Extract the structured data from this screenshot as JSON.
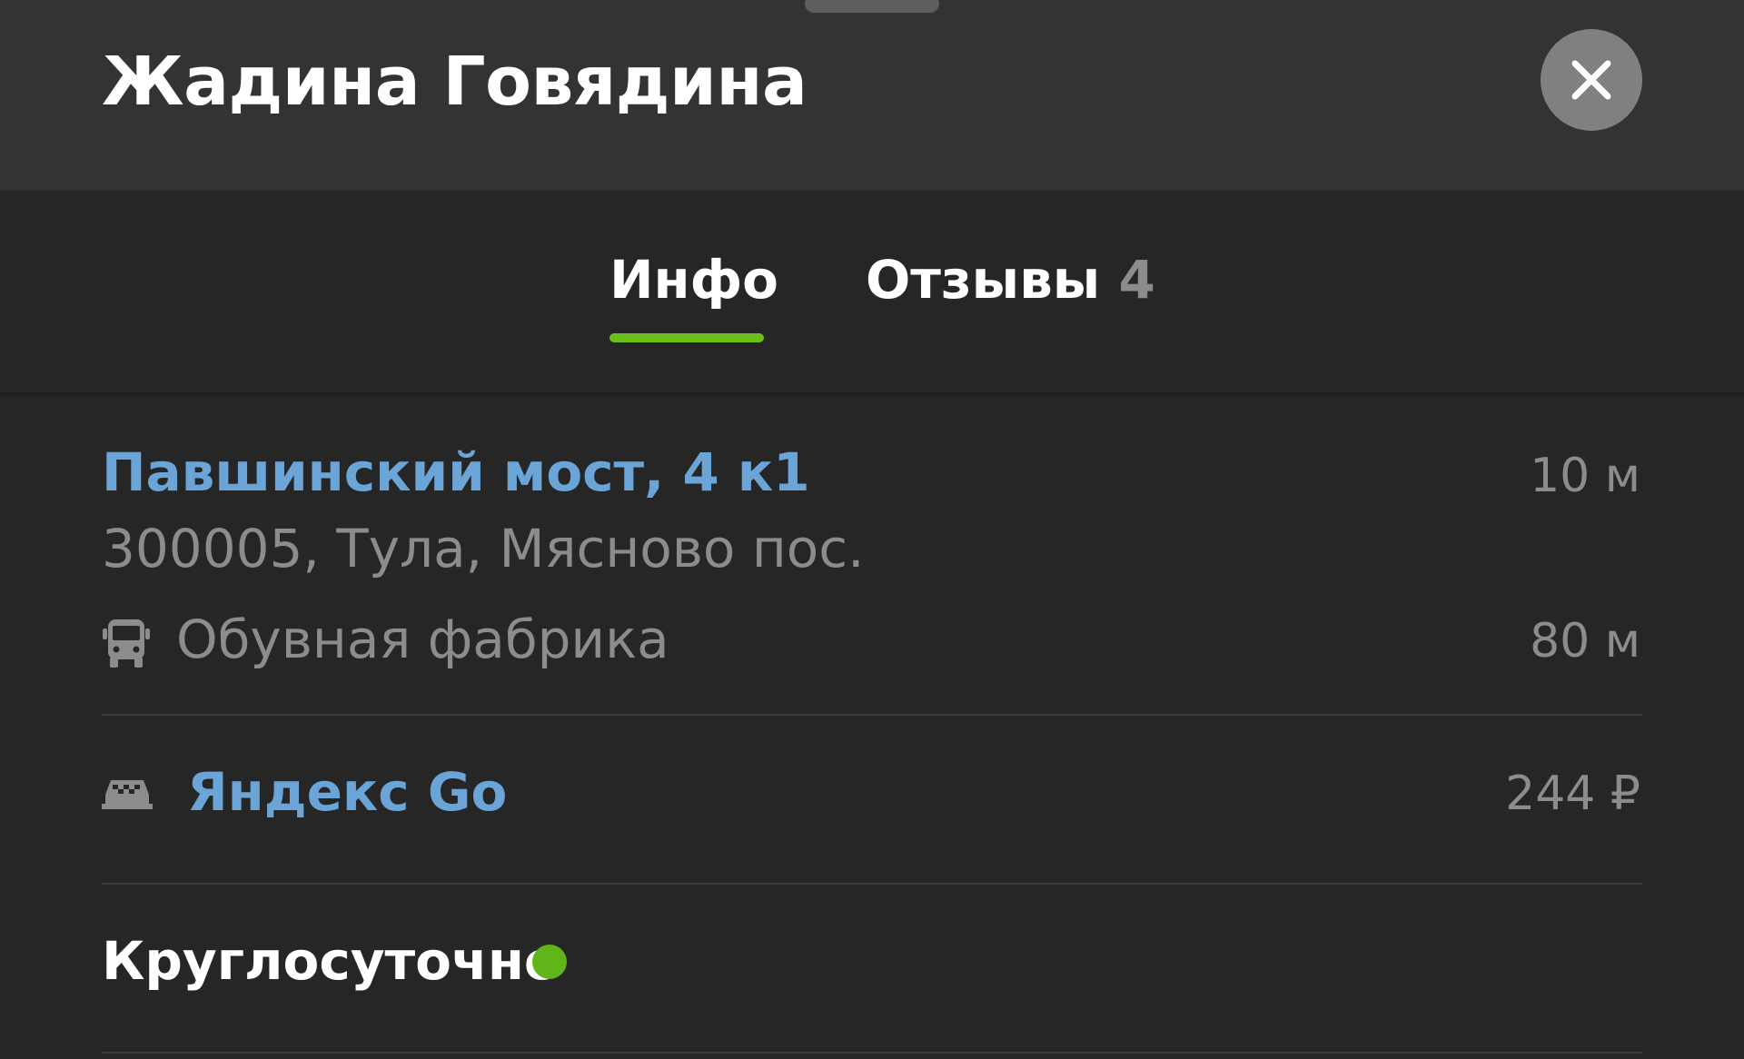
{
  "place": {
    "name": "Жадина Говядина"
  },
  "tabs": [
    {
      "label": "Инфо",
      "active": true
    },
    {
      "label": "Отзывы",
      "count": "4",
      "active": false
    }
  ],
  "address": {
    "street": "Павшинский мост, 4 к1",
    "distance": "10 м",
    "postal": "300005, Тула, Мясново пос."
  },
  "transit": {
    "icon": "bus-icon",
    "stop": "Обувная фабрика",
    "distance": "80 м"
  },
  "taxi": {
    "icon": "taxi-icon",
    "service": "Яндекс Go",
    "price": "244 ₽"
  },
  "hours": {
    "label": "Круглосуточно",
    "status_color": "#5fb51a"
  },
  "colors": {
    "accent_link": "#6ba4d6",
    "active_tab_underline": "#6ac01d",
    "header_bg": "#333333",
    "body_bg": "#262626"
  }
}
